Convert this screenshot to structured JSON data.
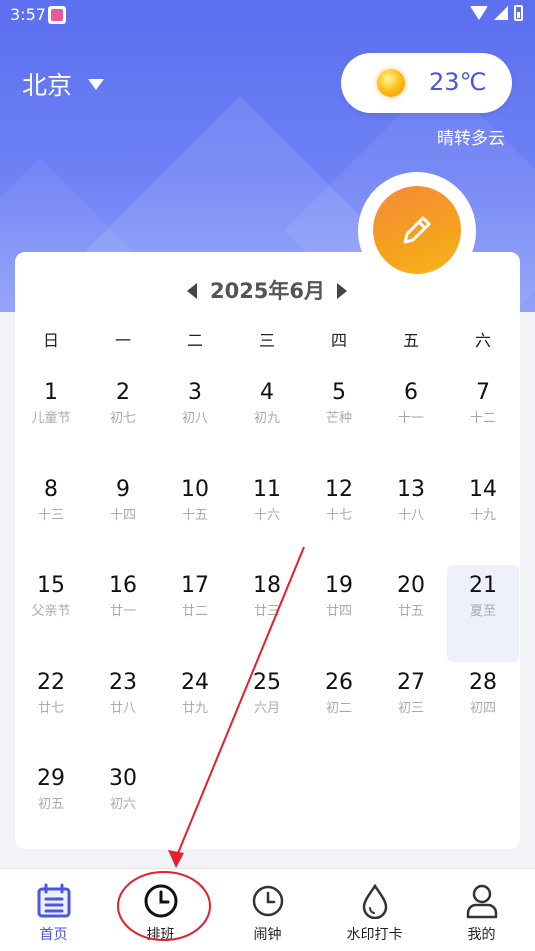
{
  "status_bar": {
    "time": "3:57"
  },
  "header": {
    "city": "北京",
    "temperature": "23℃",
    "weather_desc": "晴转多云"
  },
  "calendar": {
    "month_title": "2025年6月",
    "weekdays": [
      "日",
      "一",
      "二",
      "三",
      "四",
      "五",
      "六"
    ],
    "weeks": [
      [
        {
          "day": "1",
          "lunar": "儿童节"
        },
        {
          "day": "2",
          "lunar": "初七"
        },
        {
          "day": "3",
          "lunar": "初八"
        },
        {
          "day": "4",
          "lunar": "初九"
        },
        {
          "day": "5",
          "lunar": "芒种"
        },
        {
          "day": "6",
          "lunar": "十一"
        },
        {
          "day": "7",
          "lunar": "十二"
        }
      ],
      [
        {
          "day": "8",
          "lunar": "十三"
        },
        {
          "day": "9",
          "lunar": "十四"
        },
        {
          "day": "10",
          "lunar": "十五"
        },
        {
          "day": "11",
          "lunar": "十六"
        },
        {
          "day": "12",
          "lunar": "十七"
        },
        {
          "day": "13",
          "lunar": "十八"
        },
        {
          "day": "14",
          "lunar": "十九"
        }
      ],
      [
        {
          "day": "15",
          "lunar": "父亲节"
        },
        {
          "day": "16",
          "lunar": "廿一"
        },
        {
          "day": "17",
          "lunar": "廿二"
        },
        {
          "day": "18",
          "lunar": "廿三"
        },
        {
          "day": "19",
          "lunar": "廿四"
        },
        {
          "day": "20",
          "lunar": "廿五"
        },
        {
          "day": "21",
          "lunar": "夏至"
        }
      ],
      [
        {
          "day": "22",
          "lunar": "廿七"
        },
        {
          "day": "23",
          "lunar": "廿八"
        },
        {
          "day": "24",
          "lunar": "廿九"
        },
        {
          "day": "25",
          "lunar": "六月"
        },
        {
          "day": "26",
          "lunar": "初二"
        },
        {
          "day": "27",
          "lunar": "初三"
        },
        {
          "day": "28",
          "lunar": "初四"
        }
      ],
      [
        {
          "day": "29",
          "lunar": "初五"
        },
        {
          "day": "30",
          "lunar": "初六"
        }
      ]
    ],
    "today": "21"
  },
  "bottom_nav": [
    {
      "label": "首页",
      "icon": "calendar-list-icon",
      "active": true
    },
    {
      "label": "排班",
      "icon": "clock-icon",
      "active": false
    },
    {
      "label": "闹钟",
      "icon": "alarm-clock-icon",
      "active": false
    },
    {
      "label": "水印打卡",
      "icon": "water-drop-icon",
      "active": false
    },
    {
      "label": "我的",
      "icon": "person-icon",
      "active": false
    }
  ],
  "colors": {
    "accent": "#4a55e0",
    "hero_start": "#5b6ff0",
    "fab": "#f5a21d",
    "annotation": "#e3202c"
  }
}
